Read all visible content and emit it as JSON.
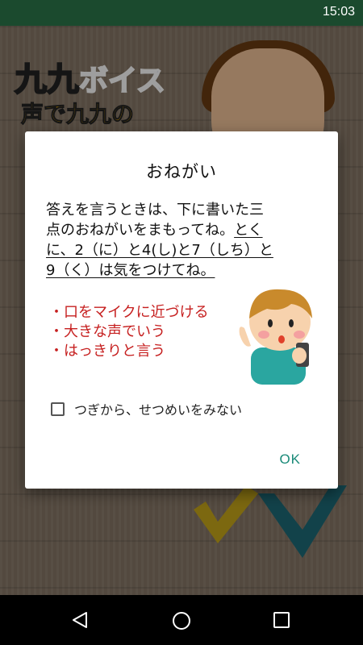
{
  "status_bar": {
    "time": "15:03"
  },
  "background_app": {
    "logo_kuku": "九九",
    "logo_voice": "ボイス",
    "logo_subtitle": "声で九九の"
  },
  "dialog": {
    "title": "おねがい",
    "body_line1": "答えを言うときは、下に書いた三",
    "body_line2_plain": "点のおねがいをまもってね。",
    "body_line2_underlined": "とく",
    "body_line3_underlined": "に、2（に）と4(し)と7（しち）と",
    "body_line4_underlined": "9（く）は気をつけてね。",
    "rules": [
      "・口をマイクに近づける",
      "・大きな声でいう",
      "・はっきりと言う"
    ],
    "checkbox_label": "つぎから、せつめいをみない",
    "checkbox_checked": false,
    "ok_label": "OK"
  },
  "colors": {
    "accent": "#198a78",
    "rule_text": "#c61f1f",
    "status_bar": "#1b4a2e"
  }
}
